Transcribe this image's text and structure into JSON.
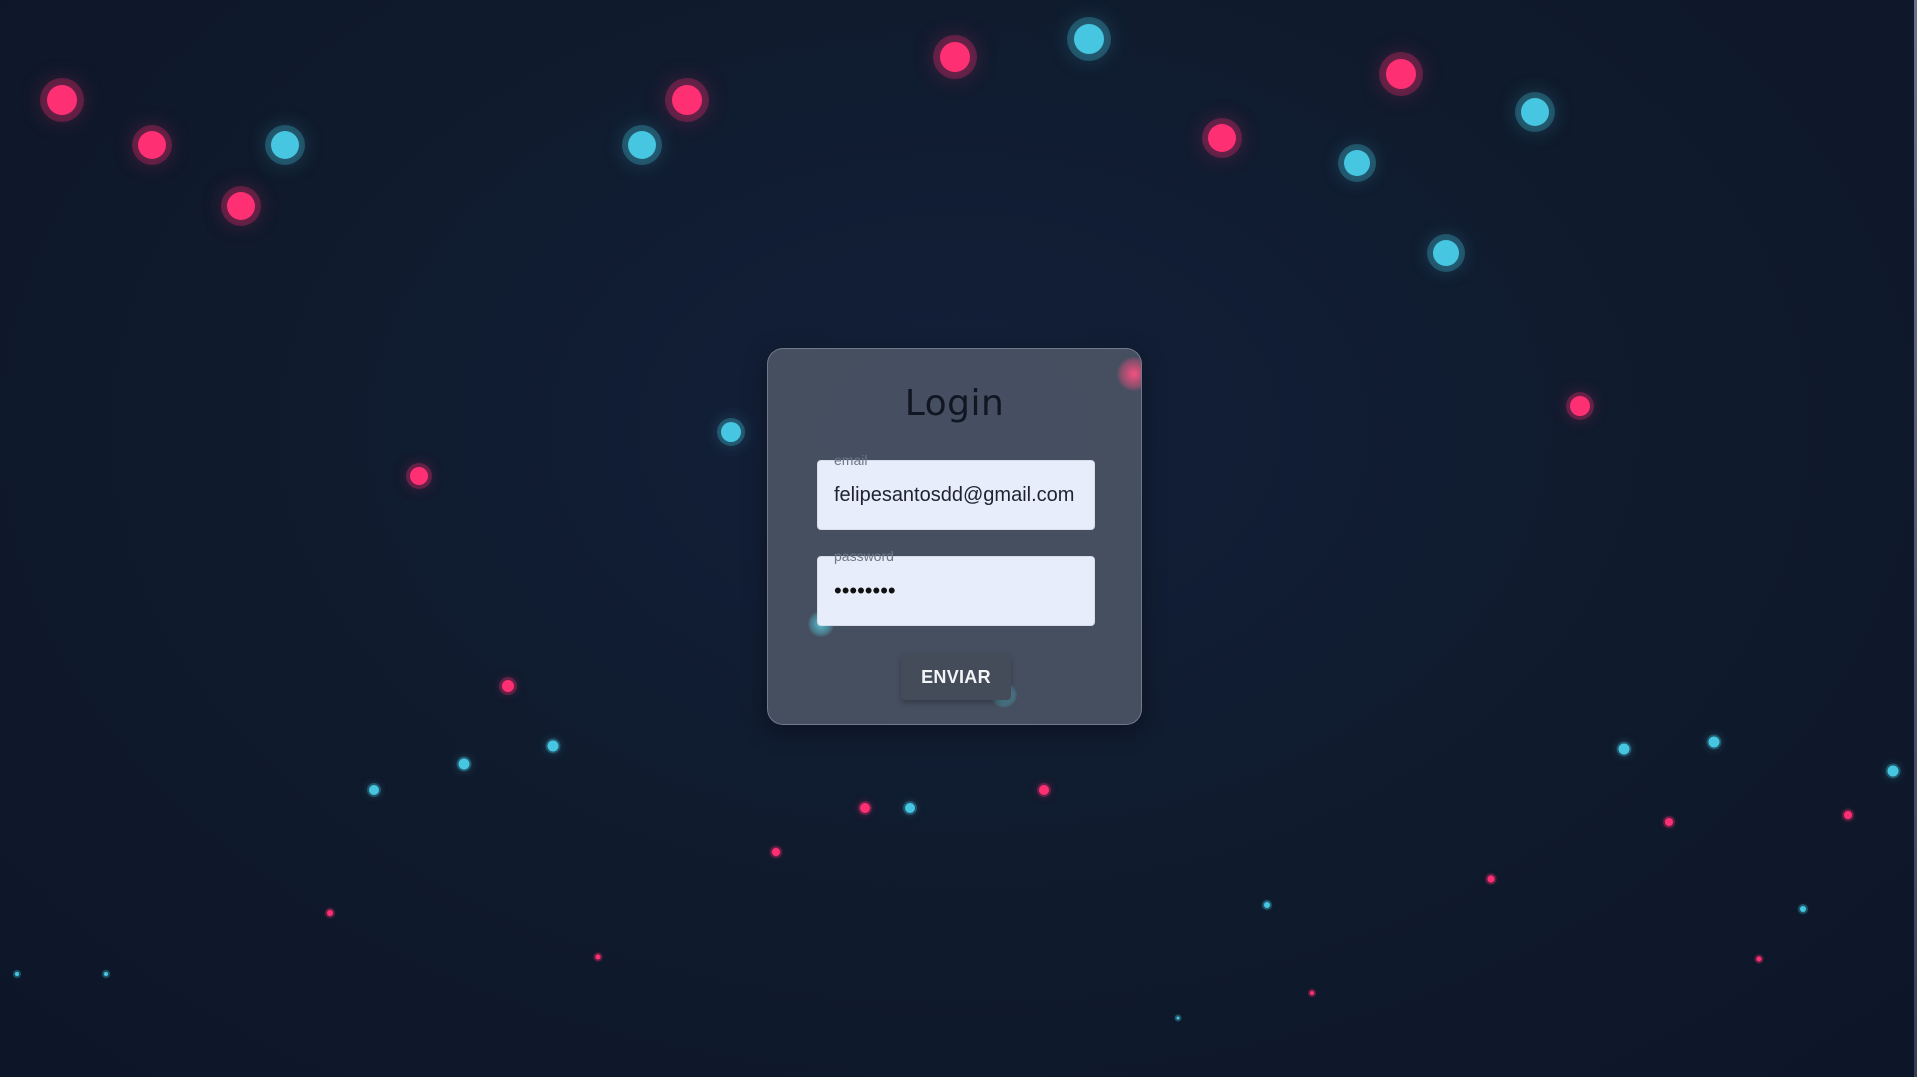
{
  "login": {
    "title": "Login",
    "email": {
      "label": "email",
      "value": "felipesantosdd@gmail.com"
    },
    "password": {
      "label": "password",
      "value": "12345678"
    },
    "submit_label": "ENVIAR"
  },
  "theme": {
    "background": "#0f1a2c",
    "particle_pink": "#ff2f73",
    "particle_cyan": "#46c6e0"
  }
}
